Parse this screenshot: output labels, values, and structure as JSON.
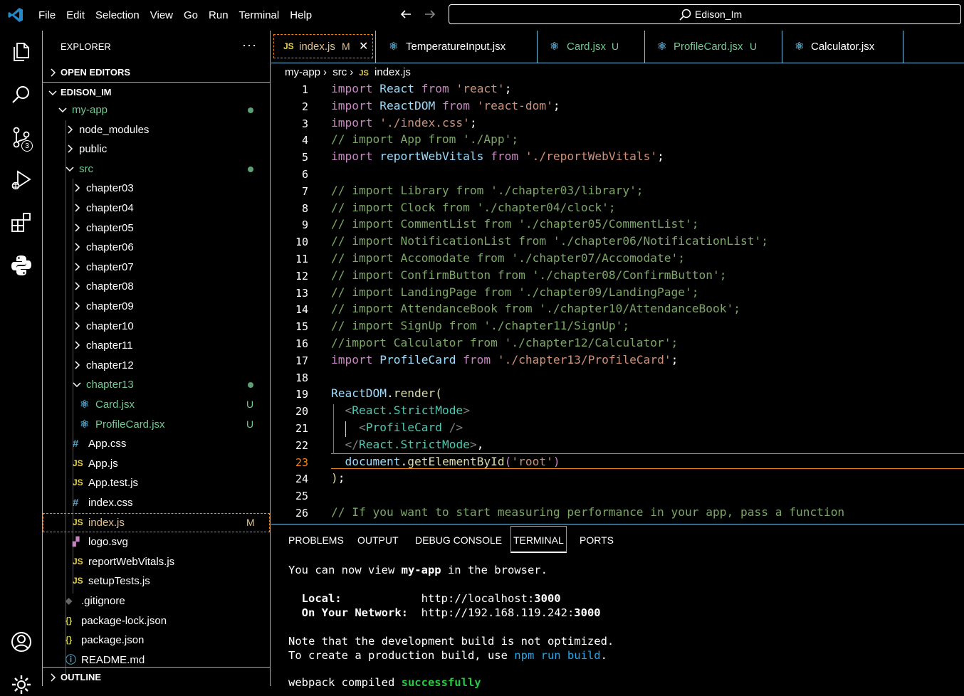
{
  "titlebar": {
    "menu": [
      "File",
      "Edit",
      "Selection",
      "View",
      "Go",
      "Run",
      "Terminal",
      "Help"
    ],
    "search_text": "Edison_Im"
  },
  "activity": {
    "source_control_badge": "3"
  },
  "sidebar": {
    "title": "EXPLORER",
    "more": "···",
    "open_editors": "OPEN EDITORS",
    "root": "EDISON_IM",
    "outline": "OUTLINE",
    "tree": [
      {
        "label": "my-app",
        "git": "dot"
      },
      {
        "label": "node_modules"
      },
      {
        "label": "public"
      },
      {
        "label": "src",
        "git": "dot"
      },
      {
        "label": "chapter03"
      },
      {
        "label": "chapter04"
      },
      {
        "label": "chapter05"
      },
      {
        "label": "chapter06"
      },
      {
        "label": "chapter07"
      },
      {
        "label": "chapter08"
      },
      {
        "label": "chapter09"
      },
      {
        "label": "chapter10"
      },
      {
        "label": "chapter11"
      },
      {
        "label": "chapter12"
      },
      {
        "label": "chapter13",
        "git": "dot"
      },
      {
        "label": "Card.jsx",
        "git": "U"
      },
      {
        "label": "ProfileCard.jsx",
        "git": "U"
      },
      {
        "label": "App.css"
      },
      {
        "label": "App.js"
      },
      {
        "label": "App.test.js"
      },
      {
        "label": "index.css"
      },
      {
        "label": "index.js",
        "git": "M"
      },
      {
        "label": "logo.svg"
      },
      {
        "label": "reportWebVitals.js"
      },
      {
        "label": "setupTests.js"
      },
      {
        "label": ".gitignore"
      },
      {
        "label": "package-lock.json"
      },
      {
        "label": "package.json"
      },
      {
        "label": "README.md"
      }
    ]
  },
  "tabs": [
    {
      "name": "index.js",
      "mark": "M",
      "close": "✕"
    },
    {
      "name": "TemperatureInput.jsx"
    },
    {
      "name": "Card.jsx",
      "mark": "U"
    },
    {
      "name": "ProfileCard.jsx",
      "mark": "U"
    },
    {
      "name": "Calculator.jsx"
    }
  ],
  "breadcrumb": [
    "my-app",
    "src",
    "index.js"
  ],
  "editor": {
    "current_line": 23,
    "lines": [
      "import React from 'react';",
      "import ReactDOM from 'react-dom';",
      "import './index.css';",
      "// import App from './App';",
      "import reportWebVitals from './reportWebVitals';",
      "",
      "// import Library from './chapter03/library';",
      "// import Clock from './chapter04/clock';",
      "// import CommentList from './chapter05/CommentList';",
      "// import NotificationList from './chapter06/NotificationList';",
      "// import Accomodate from './chapter07/Accomodate';",
      "// import ConfirmButton from './chapter08/ConfirmButton';",
      "// import LandingPage from './chapter09/LandingPage';",
      "// import AttendanceBook from './chapter10/AttendanceBook';",
      "// import SignUp from './chapter11/SignUp';",
      "//import Calculator from './chapter12/Calculator';",
      "import ProfileCard from './chapter13/ProfileCard';",
      "",
      "ReactDOM.render(",
      "  <React.StrictMode>",
      "    <ProfileCard />",
      "  </React.StrictMode>,",
      "  document.getElementById('root')",
      ");",
      "",
      "// If you want to start measuring performance in your app, pass a function"
    ]
  },
  "panel": {
    "tabs": [
      "PROBLEMS",
      "OUTPUT",
      "DEBUG CONSOLE",
      "TERMINAL",
      "PORTS"
    ],
    "selected": "TERMINAL",
    "terminal": {
      "l1_a": "You can now view ",
      "l1_b": "my-app",
      "l1_c": " in the browser.",
      "local_label": "Local:",
      "local_url_a": "http://localhost:",
      "local_url_b": "3000",
      "net_label": "On Your Network:",
      "net_url_a": "http://192.168.119.242:",
      "net_url_b": "3000",
      "note1": "Note that the development build is not optimized.",
      "note2_a": "To create a production build, use ",
      "note2_b": "npm run build",
      "note2_c": ".",
      "compiled_a": "webpack compiled ",
      "compiled_b": "successfully"
    }
  }
}
